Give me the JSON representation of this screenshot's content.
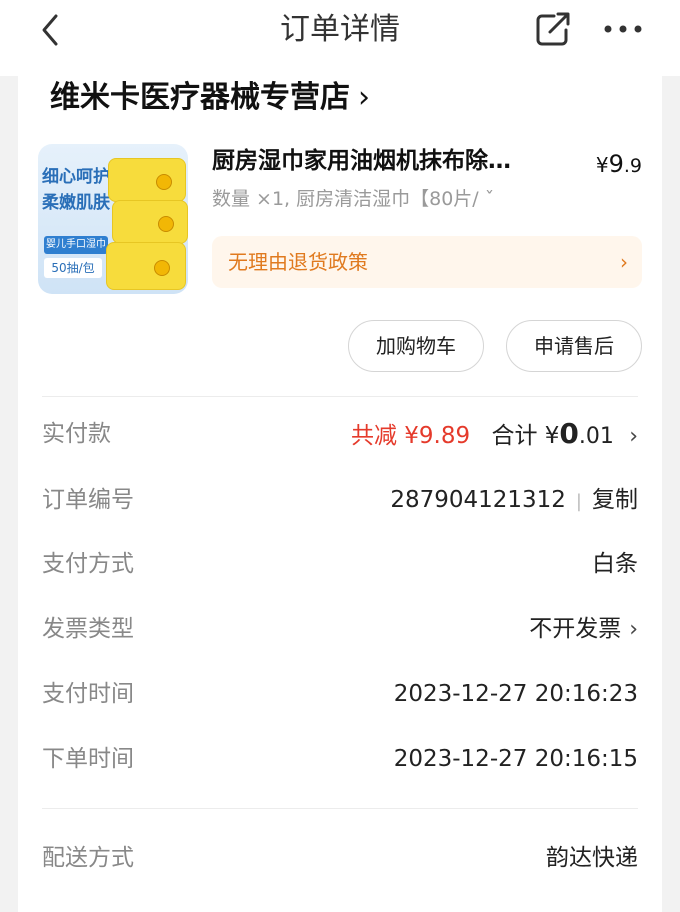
{
  "nav": {
    "title": "订单详情"
  },
  "shop": {
    "name": "维米卡医疗器械专营店",
    "chevron": "›"
  },
  "product": {
    "name": "厨房湿巾家用油烟机抹布除…",
    "price_currency": "¥",
    "price_int": "9",
    "price_dec": ".9",
    "spec": "数量 ×1, 厨房清洁湿巾【80片/ ˇ",
    "thumb_line1": "细心呵护",
    "thumb_line2": "柔嫩肌肤",
    "thumb_tag1": "婴儿手口湿巾",
    "thumb_tag2": "50抽/包",
    "policy": "无理由退货政策",
    "policy_chevron": "›"
  },
  "actions": {
    "cart": "加购物车",
    "after_sales": "申请售后"
  },
  "details": {
    "paid_label": "实付款",
    "discount": "共减 ¥9.89",
    "total_prefix": "合计 ¥",
    "total_int": "0",
    "total_dec": ".01",
    "order_no_label": "订单编号",
    "order_no": "287904121312",
    "copy_label": "复制",
    "pay_method_label": "支付方式",
    "pay_method": "白条",
    "invoice_label": "发票类型",
    "invoice": "不开发票",
    "pay_time_label": "支付时间",
    "pay_time": "2023-12-27 20:16:23",
    "order_time_label": "下单时间",
    "order_time": "2023-12-27 20:16:15",
    "delivery_label": "配送方式",
    "delivery": "韵达快递"
  },
  "colors": {
    "accent_red": "#e53a2b",
    "policy_orange": "#e07a1f",
    "policy_bg": "#fff6ec"
  }
}
